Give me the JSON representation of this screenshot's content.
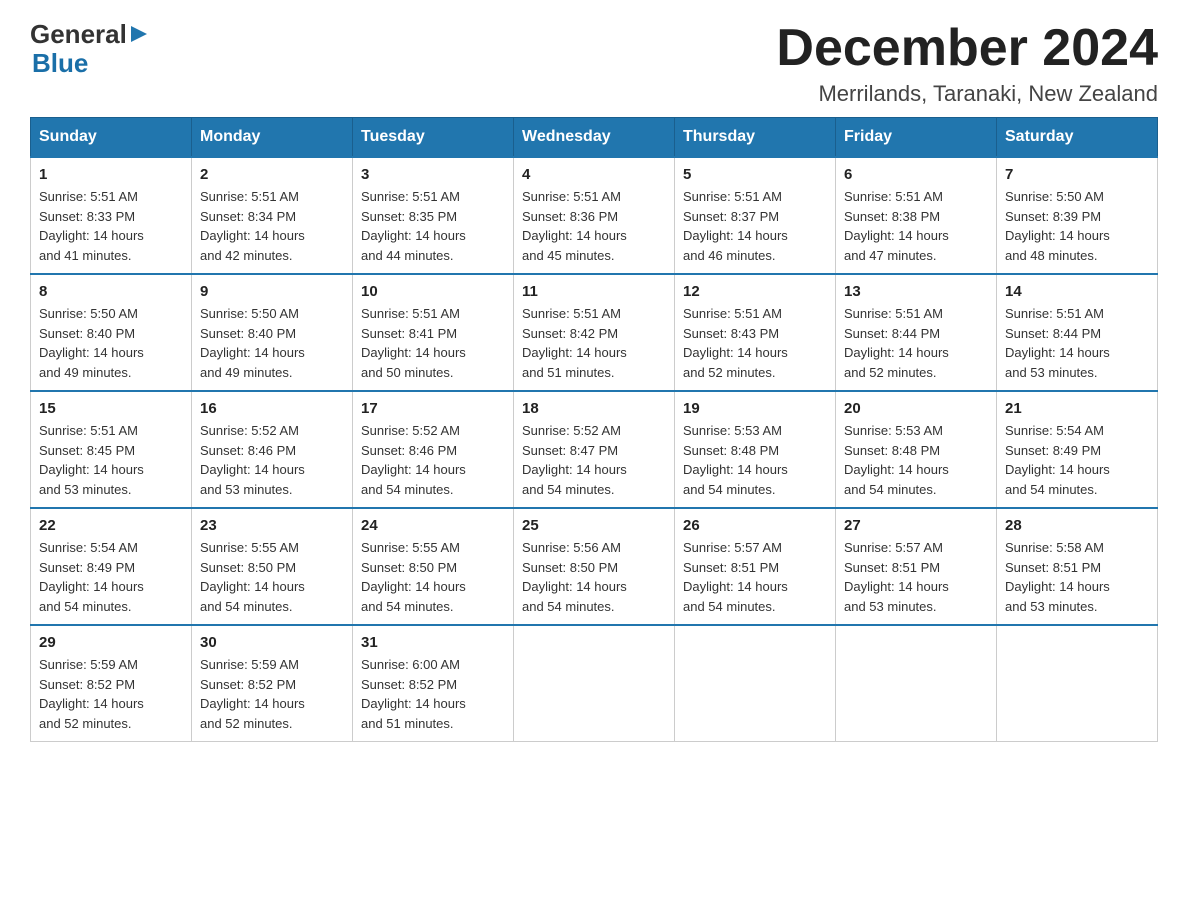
{
  "header": {
    "logo_general": "General",
    "logo_blue": "Blue",
    "month_title": "December 2024",
    "location": "Merrilands, Taranaki, New Zealand"
  },
  "days_of_week": [
    "Sunday",
    "Monday",
    "Tuesday",
    "Wednesday",
    "Thursday",
    "Friday",
    "Saturday"
  ],
  "weeks": [
    [
      {
        "day": "1",
        "sunrise": "5:51 AM",
        "sunset": "8:33 PM",
        "daylight": "14 hours and 41 minutes."
      },
      {
        "day": "2",
        "sunrise": "5:51 AM",
        "sunset": "8:34 PM",
        "daylight": "14 hours and 42 minutes."
      },
      {
        "day": "3",
        "sunrise": "5:51 AM",
        "sunset": "8:35 PM",
        "daylight": "14 hours and 44 minutes."
      },
      {
        "day": "4",
        "sunrise": "5:51 AM",
        "sunset": "8:36 PM",
        "daylight": "14 hours and 45 minutes."
      },
      {
        "day": "5",
        "sunrise": "5:51 AM",
        "sunset": "8:37 PM",
        "daylight": "14 hours and 46 minutes."
      },
      {
        "day": "6",
        "sunrise": "5:51 AM",
        "sunset": "8:38 PM",
        "daylight": "14 hours and 47 minutes."
      },
      {
        "day": "7",
        "sunrise": "5:50 AM",
        "sunset": "8:39 PM",
        "daylight": "14 hours and 48 minutes."
      }
    ],
    [
      {
        "day": "8",
        "sunrise": "5:50 AM",
        "sunset": "8:40 PM",
        "daylight": "14 hours and 49 minutes."
      },
      {
        "day": "9",
        "sunrise": "5:50 AM",
        "sunset": "8:40 PM",
        "daylight": "14 hours and 49 minutes."
      },
      {
        "day": "10",
        "sunrise": "5:51 AM",
        "sunset": "8:41 PM",
        "daylight": "14 hours and 50 minutes."
      },
      {
        "day": "11",
        "sunrise": "5:51 AM",
        "sunset": "8:42 PM",
        "daylight": "14 hours and 51 minutes."
      },
      {
        "day": "12",
        "sunrise": "5:51 AM",
        "sunset": "8:43 PM",
        "daylight": "14 hours and 52 minutes."
      },
      {
        "day": "13",
        "sunrise": "5:51 AM",
        "sunset": "8:44 PM",
        "daylight": "14 hours and 52 minutes."
      },
      {
        "day": "14",
        "sunrise": "5:51 AM",
        "sunset": "8:44 PM",
        "daylight": "14 hours and 53 minutes."
      }
    ],
    [
      {
        "day": "15",
        "sunrise": "5:51 AM",
        "sunset": "8:45 PM",
        "daylight": "14 hours and 53 minutes."
      },
      {
        "day": "16",
        "sunrise": "5:52 AM",
        "sunset": "8:46 PM",
        "daylight": "14 hours and 53 minutes."
      },
      {
        "day": "17",
        "sunrise": "5:52 AM",
        "sunset": "8:46 PM",
        "daylight": "14 hours and 54 minutes."
      },
      {
        "day": "18",
        "sunrise": "5:52 AM",
        "sunset": "8:47 PM",
        "daylight": "14 hours and 54 minutes."
      },
      {
        "day": "19",
        "sunrise": "5:53 AM",
        "sunset": "8:48 PM",
        "daylight": "14 hours and 54 minutes."
      },
      {
        "day": "20",
        "sunrise": "5:53 AM",
        "sunset": "8:48 PM",
        "daylight": "14 hours and 54 minutes."
      },
      {
        "day": "21",
        "sunrise": "5:54 AM",
        "sunset": "8:49 PM",
        "daylight": "14 hours and 54 minutes."
      }
    ],
    [
      {
        "day": "22",
        "sunrise": "5:54 AM",
        "sunset": "8:49 PM",
        "daylight": "14 hours and 54 minutes."
      },
      {
        "day": "23",
        "sunrise": "5:55 AM",
        "sunset": "8:50 PM",
        "daylight": "14 hours and 54 minutes."
      },
      {
        "day": "24",
        "sunrise": "5:55 AM",
        "sunset": "8:50 PM",
        "daylight": "14 hours and 54 minutes."
      },
      {
        "day": "25",
        "sunrise": "5:56 AM",
        "sunset": "8:50 PM",
        "daylight": "14 hours and 54 minutes."
      },
      {
        "day": "26",
        "sunrise": "5:57 AM",
        "sunset": "8:51 PM",
        "daylight": "14 hours and 54 minutes."
      },
      {
        "day": "27",
        "sunrise": "5:57 AM",
        "sunset": "8:51 PM",
        "daylight": "14 hours and 53 minutes."
      },
      {
        "day": "28",
        "sunrise": "5:58 AM",
        "sunset": "8:51 PM",
        "daylight": "14 hours and 53 minutes."
      }
    ],
    [
      {
        "day": "29",
        "sunrise": "5:59 AM",
        "sunset": "8:52 PM",
        "daylight": "14 hours and 52 minutes."
      },
      {
        "day": "30",
        "sunrise": "5:59 AM",
        "sunset": "8:52 PM",
        "daylight": "14 hours and 52 minutes."
      },
      {
        "day": "31",
        "sunrise": "6:00 AM",
        "sunset": "8:52 PM",
        "daylight": "14 hours and 51 minutes."
      },
      null,
      null,
      null,
      null
    ]
  ],
  "labels": {
    "sunrise": "Sunrise:",
    "sunset": "Sunset:",
    "daylight": "Daylight:"
  }
}
